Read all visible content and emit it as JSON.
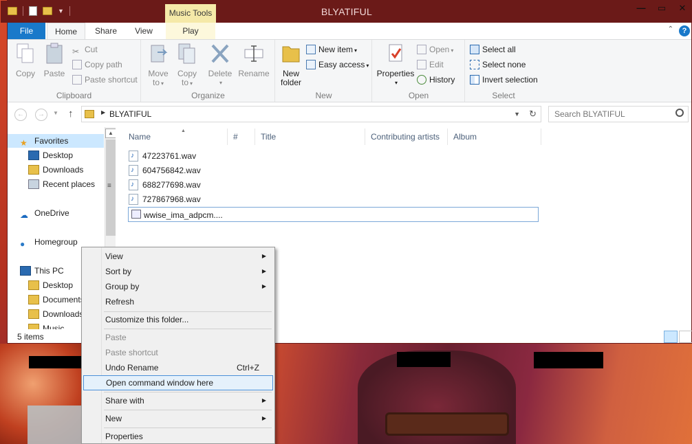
{
  "window": {
    "title": "BLYATIFUL",
    "context_tab": "Music Tools"
  },
  "tabs": {
    "file": "File",
    "home": "Home",
    "share": "Share",
    "view": "View",
    "play": "Play"
  },
  "ribbon": {
    "clipboard": {
      "label": "Clipboard",
      "copy": "Copy",
      "paste": "Paste",
      "cut": "Cut",
      "copy_path": "Copy path",
      "paste_shortcut": "Paste shortcut"
    },
    "organize": {
      "label": "Organize",
      "move_to": "Move",
      "move_to2": "to",
      "copy_to": "Copy",
      "copy_to2": "to",
      "delete": "Delete",
      "rename": "Rename"
    },
    "new": {
      "label": "New",
      "new_folder": "New",
      "new_folder2": "folder",
      "new_item": "New item",
      "easy_access": "Easy access"
    },
    "open": {
      "label": "Open",
      "properties": "Properties",
      "open": "Open",
      "edit": "Edit",
      "history": "History"
    },
    "select": {
      "label": "Select",
      "select_all": "Select all",
      "select_none": "Select none",
      "invert": "Invert selection"
    }
  },
  "address": {
    "path": "BLYATIFUL",
    "search_placeholder": "Search BLYATIFUL"
  },
  "nav": {
    "favorites": "Favorites",
    "desktop": "Desktop",
    "downloads": "Downloads",
    "recent": "Recent places",
    "onedrive": "OneDrive",
    "homegroup": "Homegroup",
    "this_pc": "This PC",
    "pc_desktop": "Desktop",
    "pc_documents": "Documents",
    "pc_downloads": "Downloads",
    "pc_music": "Music"
  },
  "columns": {
    "name": "Name",
    "number": "#",
    "title": "Title",
    "artists": "Contributing artists",
    "album": "Album"
  },
  "files": [
    "47223761.wav",
    "604756842.wav",
    "688277698.wav",
    "727867968.wav"
  ],
  "rename_value": "wwise_ima_adpcm....",
  "status": {
    "items": "5 items"
  },
  "context_menu": {
    "view": "View",
    "sort_by": "Sort by",
    "group_by": "Group by",
    "refresh": "Refresh",
    "customize": "Customize this folder...",
    "paste": "Paste",
    "paste_shortcut": "Paste shortcut",
    "undo_rename": "Undo Rename",
    "undo_shortcut": "Ctrl+Z",
    "open_cmd": "Open command window here",
    "share_with": "Share with",
    "new": "New",
    "properties": "Properties"
  },
  "colors": {
    "titlebar": "#6b1a18",
    "accent": "#1979ca",
    "context_tab": "#f5e9a8",
    "highlight": "#e5f1fb"
  }
}
